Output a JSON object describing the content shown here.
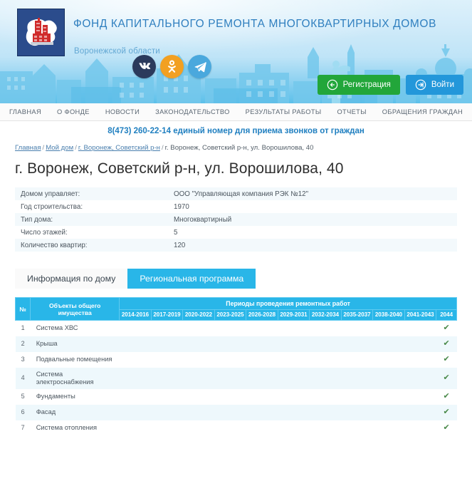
{
  "header": {
    "title": "ФОНД КАПИТАЛЬНОГО РЕМОНТА МНОГОКВАРТИРНЫХ ДОМОВ",
    "subtitle": "Воронежской области",
    "logo_alt": "Герб Воронежской области",
    "social": [
      {
        "name": "vk",
        "label": "VK"
      },
      {
        "name": "ok",
        "label": "OK"
      },
      {
        "name": "telegram",
        "label": "Telegram"
      }
    ],
    "register_label": "Регистрация",
    "login_label": "Войти",
    "colors": {
      "register_green": "#22a63a",
      "login_blue": "#2397da",
      "title_blue": "#2f7fbf",
      "accent": "#29b6e8"
    }
  },
  "nav": {
    "items": [
      {
        "label": "ГЛАВНАЯ"
      },
      {
        "label": "О ФОНДЕ"
      },
      {
        "label": "НОВОСТИ"
      },
      {
        "label": "ЗАКОНОДАТЕЛЬСТВО"
      },
      {
        "label": "РЕЗУЛЬТАТЫ РАБОТЫ"
      },
      {
        "label": "ОТЧЕТЫ"
      },
      {
        "label": "ОБРАЩЕНИЯ ГРАЖДАН"
      }
    ]
  },
  "phone_line": "8(473) 260-22-14 единый номер для приема звонков от граждан",
  "breadcrumb": {
    "items": [
      {
        "label": "Главная",
        "link": true
      },
      {
        "label": "Мой дом",
        "link": true
      },
      {
        "label": "г. Воронеж, Советский р-н",
        "link": true
      },
      {
        "label": "г. Воронеж, Советский р-н, ул. Ворошилова, 40",
        "link": false
      }
    ],
    "separator": "/"
  },
  "page_title": "г. Воронеж, Советский р-н, ул. Ворошилова, 40",
  "house_info": {
    "rows": [
      {
        "key": "Домом управляет:",
        "value": "ООО \"Управляющая компания РЭК №12\""
      },
      {
        "key": "Год строительства:",
        "value": "1970"
      },
      {
        "key": "Тип дома:",
        "value": "Многоквартирный"
      },
      {
        "key": "Число этажей:",
        "value": "5"
      },
      {
        "key": "Количество квартир:",
        "value": "120"
      }
    ]
  },
  "tabs": [
    {
      "label": "Информация по дому",
      "active": false
    },
    {
      "label": "Региональная программа",
      "active": true
    }
  ],
  "program_table": {
    "col_num": "№",
    "col_object": "Объекты общего имущества",
    "periods_header": "Периоды проведения ремонтных работ",
    "periods": [
      "2014-2016",
      "2017-2019",
      "2020-2022",
      "2023-2025",
      "2026-2028",
      "2029-2031",
      "2032-2034",
      "2035-2037",
      "2038-2040",
      "2041-2043",
      "2044"
    ],
    "check_glyph": "✔",
    "rows": [
      {
        "num": "1",
        "object": "Система ХВС",
        "marks": [
          0,
          0,
          0,
          0,
          0,
          0,
          0,
          0,
          0,
          0,
          1
        ]
      },
      {
        "num": "2",
        "object": "Крыша",
        "marks": [
          0,
          0,
          0,
          0,
          0,
          0,
          0,
          0,
          0,
          0,
          1
        ]
      },
      {
        "num": "3",
        "object": "Подвальные помещения",
        "marks": [
          0,
          0,
          0,
          0,
          0,
          0,
          0,
          0,
          0,
          0,
          1
        ]
      },
      {
        "num": "4",
        "object": "Система электроснабжения",
        "marks": [
          0,
          0,
          0,
          0,
          0,
          0,
          0,
          0,
          0,
          0,
          1
        ]
      },
      {
        "num": "5",
        "object": "Фундаменты",
        "marks": [
          0,
          0,
          0,
          0,
          0,
          0,
          0,
          0,
          0,
          0,
          1
        ]
      },
      {
        "num": "6",
        "object": "Фасад",
        "marks": [
          0,
          0,
          0,
          0,
          0,
          0,
          0,
          0,
          0,
          0,
          1
        ]
      },
      {
        "num": "7",
        "object": "Система отопления",
        "marks": [
          0,
          0,
          0,
          0,
          0,
          0,
          0,
          0,
          0,
          0,
          1
        ]
      }
    ]
  }
}
